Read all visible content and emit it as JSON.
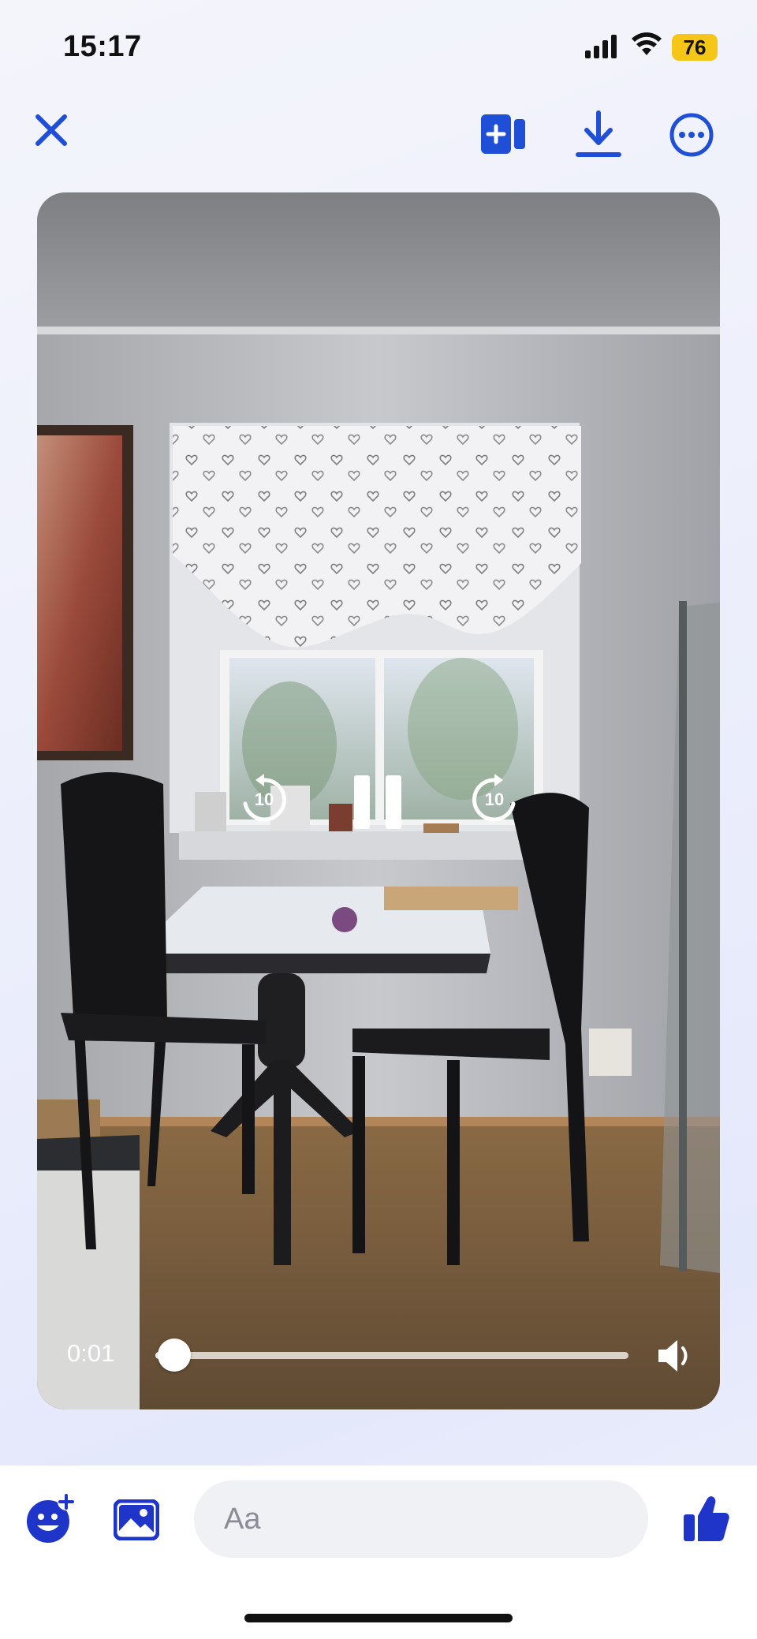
{
  "status_bar": {
    "time": "15:17",
    "battery_level": "76",
    "signal_icon": "cellular-signal-icon",
    "wifi_icon": "wifi-icon"
  },
  "toolbar": {
    "close_icon": "close-icon",
    "share_icon": "add-to-story-icon",
    "download_icon": "download-icon",
    "more_icon": "more-options-icon"
  },
  "video": {
    "current_time": "0:01",
    "progress_fraction": 0.04,
    "skip_back_seconds": "10",
    "skip_forward_seconds": "10",
    "state": "playing"
  },
  "composer": {
    "input_placeholder": "Aa",
    "input_value": ""
  },
  "colors": {
    "accent": "#1f4fd6",
    "battery": "#f5c518"
  }
}
